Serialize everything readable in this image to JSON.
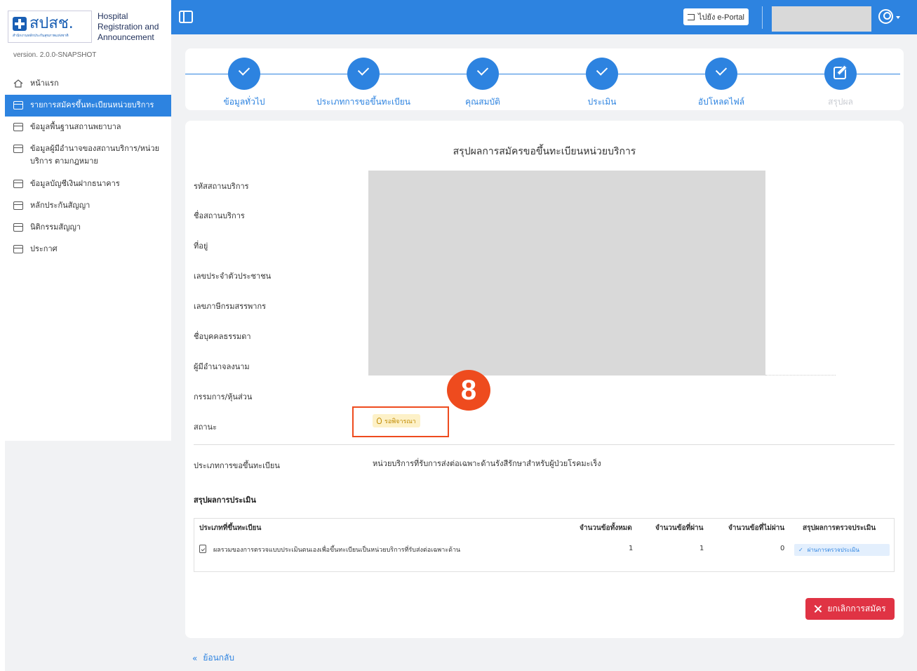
{
  "app": {
    "logo_thai": "สปสช.",
    "logo_subtitle": "สำนักงานหลักประกันสุขภาพแห่งชาติ",
    "logo_text": [
      "Hospital",
      "Registration and",
      "Announcement"
    ],
    "version": "version. 2.0.0-SNAPSHOT"
  },
  "sidebar": {
    "items": [
      {
        "label": "หน้าแรก",
        "icon": "home-icon",
        "active": false
      },
      {
        "label": "รายการสมัครขึ้นทะเบียนหน่วยบริการ",
        "icon": "window-icon",
        "active": true
      },
      {
        "label": "ข้อมูลพื้นฐานสถานพยาบาล",
        "icon": "window-icon",
        "active": false
      },
      {
        "label": "ข้อมูลผู้มีอำนาจของสถานบริการ/หน่วยบริการ ตามกฎหมาย",
        "icon": "window-icon",
        "active": false
      },
      {
        "label": "ข้อมูลบัญชีเงินฝากธนาคาร",
        "icon": "window-icon",
        "active": false
      },
      {
        "label": "หลักประกันสัญญา",
        "icon": "window-icon",
        "active": false
      },
      {
        "label": "นิติกรรมสัญญา",
        "icon": "window-icon",
        "active": false
      },
      {
        "label": "ประกาศ",
        "icon": "window-icon",
        "active": false
      }
    ]
  },
  "header": {
    "portal_label": "ไปยัง e-Portal"
  },
  "stepper": {
    "steps": [
      {
        "label": "ข้อมูลทั่วไป",
        "done": true
      },
      {
        "label": "ประเภทการขอขึ้นทะเบียน",
        "done": true
      },
      {
        "label": "คุณสมบัติ",
        "done": true
      },
      {
        "label": "ประเมิน",
        "done": true
      },
      {
        "label": "อัปโหลดไฟล์",
        "done": true
      },
      {
        "label": "สรุปผล",
        "done": false
      }
    ]
  },
  "summary": {
    "title": "สรุปผลการสมัครขอขึ้นทะเบียนหน่วยบริการ",
    "fields": [
      "รหัสสถานบริการ",
      "ชื่อสถานบริการ",
      "ที่อยู่",
      "เลขประจำตัวประชาชน",
      "เลขภาษีกรมสรรพากร",
      "ชื่อบุคคลธรรมดา",
      "ผู้มีอำนาจลงนาม",
      "กรรมการ/หุ้นส่วน",
      "สถานะ"
    ],
    "status_value": "รอพิจารณา",
    "annotation_number": "8",
    "registration_type_label": "ประเภทการขอขึ้นทะเบียน",
    "registration_type_value": "หน่วยบริการที่รับการส่งต่อเฉพาะด้านรังสีรักษาสำหรับผู้ป่วยโรคมะเร็ง",
    "assessment_title": "สรุปผลการประเมิน"
  },
  "table": {
    "headers": [
      "ประเภทที่ขึ้นทะเบียน",
      "จำนวนข้อทั้งหมด",
      "จำนวนข้อที่ผ่าน",
      "จำนวนข้อที่ไม่ผ่าน",
      "สรุปผลการตรวจประเมิน"
    ],
    "rows": [
      {
        "type": "ผลรวมของการตรวจแบบประเมินตนเองเพื่อขึ้นทะเบียนเป็นหน่วยบริการที่รับส่งต่อเฉพาะด้าน",
        "total": "1",
        "passed": "1",
        "failed": "0",
        "result": "ผ่านการตรวจประเมิน"
      }
    ]
  },
  "actions": {
    "cancel_label": "ยกเลิกการสมัคร",
    "back_label": "ย้อนกลับ"
  },
  "colors": {
    "primary": "#2d83e0",
    "danger": "#e03344",
    "annotation": "#ee4b1e",
    "pending_bg": "#fdf1c8",
    "pending_text": "#c08a00"
  }
}
